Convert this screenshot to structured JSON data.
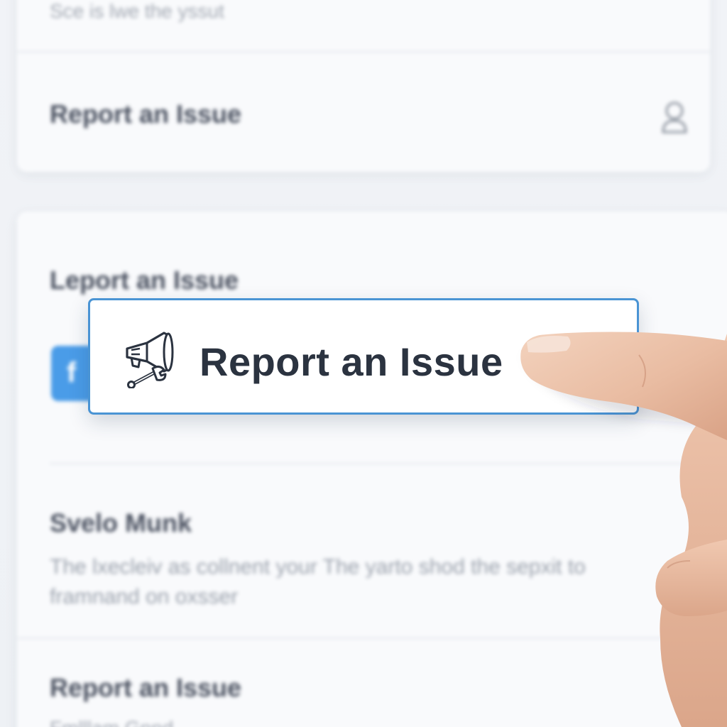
{
  "top_card": {
    "partial_text": "Sce is lwe the yssut",
    "row_title": "Report an Issue",
    "row_icon": "user-icon"
  },
  "main_card": {
    "section_title": "Leport an Issue",
    "chip_icon": "facebook-icon",
    "chip_glyph": "f",
    "focused_button": {
      "label": "Report an Issue",
      "icon": "megaphone-wrench-icon",
      "border_color": "#4a94d4"
    },
    "info_title": "Svelo Munk",
    "info_text": "The lxecleiv as collnent your The yarto shod the sepxit to framnand on oxsser",
    "bottom_title": "Report an Issue",
    "bottom_partial_text": "Fmlllam Gnnd"
  },
  "colors": {
    "accent": "#4a94d4",
    "chip": "#4a9ce8",
    "background": "#eef1f5"
  }
}
